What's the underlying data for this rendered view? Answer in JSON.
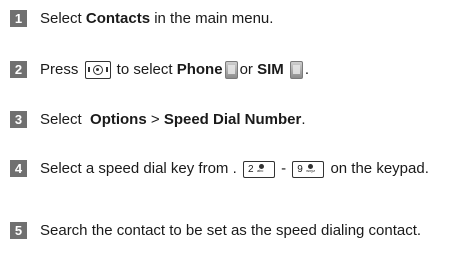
{
  "steps": [
    {
      "num": "1",
      "a": "Select ",
      "b1": "Contacts",
      "c": " in the main menu."
    },
    {
      "num": "2",
      "a": "Press ",
      "key_icon": "navigation-key-icon",
      "c": " to select ",
      "b1": "Phone",
      "icon1": "phone-memory-icon",
      "d": "or ",
      "b2": "SIM",
      "icon2": "sim-card-icon",
      "e": "."
    },
    {
      "num": "3",
      "a": "Select  ",
      "b1": "Options",
      "c": " > ",
      "b2": "Speed Dial Number",
      "d": "."
    },
    {
      "num": "4",
      "a": "Select a speed dial key from . ",
      "key1": {
        "digit": "2",
        "sub": "abc"
      },
      "sep": " - ",
      "key2": {
        "digit": "9",
        "sub": "wxyz"
      },
      "c": " on the keypad."
    },
    {
      "num": "5",
      "text": "Search the contact to be set as the speed dialing contact."
    }
  ]
}
